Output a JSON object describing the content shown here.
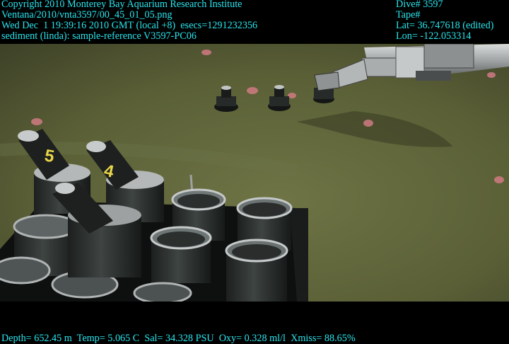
{
  "overlay": {
    "copyright": "Copyright 2010 Monterey Bay Aquarium Research Institute",
    "file_path": "Ventana/2010/vnta3597/00_45_01_05.png",
    "timestamp": "Wed Dec  1 19:39:16 2010 GMT (local +8)  esecs=1291232356",
    "annotation": "sediment (linda): sample-reference V3597-PC06",
    "dive": "Dive# 3597",
    "tape": "Tape#",
    "lat": "Lat= 36.747618 (edited)",
    "lon": "Lon= -122.053314",
    "telemetry": "Depth= 652.45 m  Temp= 5.065 C  Sal= 34.328 PSU  Oxy= 0.328 ml/l  Xmiss= 88.65%"
  },
  "scene": {
    "core_labels": [
      "5",
      "4"
    ],
    "colors": {
      "overlay_text": "#29e6ee",
      "seafloor": "#5d6338",
      "band": "#000000"
    }
  }
}
